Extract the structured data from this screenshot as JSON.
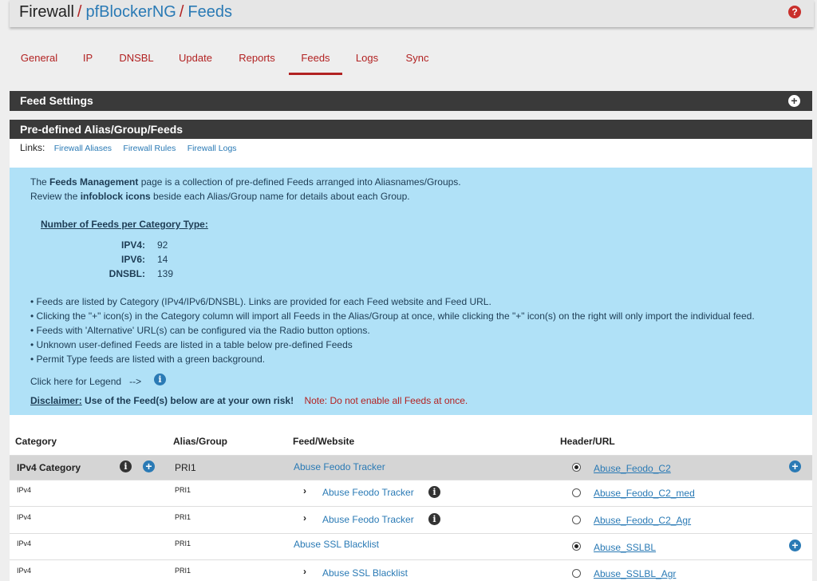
{
  "breadcrumb": {
    "root": "Firewall",
    "sep": "/",
    "package": "pfBlockerNG",
    "page": "Feeds"
  },
  "help_icon": "?",
  "tabs": [
    {
      "label": "General"
    },
    {
      "label": "IP"
    },
    {
      "label": "DNSBL"
    },
    {
      "label": "Update"
    },
    {
      "label": "Reports"
    },
    {
      "label": "Feeds",
      "active": true
    },
    {
      "label": "Logs"
    },
    {
      "label": "Sync"
    }
  ],
  "feed_settings": {
    "title": "Feed Settings",
    "toggle": "+"
  },
  "predefined": {
    "title": "Pre-defined Alias/Group/Feeds"
  },
  "links": {
    "label": "Links:",
    "items": [
      "Firewall Aliases",
      "Firewall Rules",
      "Firewall Logs"
    ]
  },
  "info": {
    "line1_pre": "The ",
    "line1_bold": "Feeds Management",
    "line1_post": " page is a collection of pre-defined Feeds arranged into Aliasnames/Groups.",
    "line2_pre": "Review the ",
    "line2_bold": "infoblock icons",
    "line2_post": " beside each Alias/Group name for details about each Group.",
    "count_heading": "Number of Feeds per Category Type:",
    "counts": [
      {
        "key": "IPV4:",
        "value": "92"
      },
      {
        "key": "IPV6:",
        "value": "14"
      },
      {
        "key": "DNSBL:",
        "value": "139"
      }
    ],
    "bullets": [
      "• Feeds are listed by Category (IPv4/IPv6/DNSBL). Links are provided for each Feed website and Feed URL.",
      "• Clicking the \"+\" icon(s) in the Category column will import all Feeds in the Alias/Group at once, while clicking the \"+\" icon(s) on the right will only import the individual feed.",
      "• Feeds with 'Alternative' URL(s) can be configured via the Radio button options.",
      "• Unknown user-defined Feeds are listed in a table below pre-defined Feeds",
      "• Permit Type feeds are listed with a green background."
    ],
    "legend_text": "Click here for Legend",
    "legend_arrow": "-->",
    "disclaimer_label": "Disclaimer:",
    "disclaimer_text": " Use of the Feed(s) below are at your own risk!",
    "note": "Note: Do not enable all Feeds at once."
  },
  "table": {
    "headers": {
      "category": "Category",
      "alias": "Alias/Group",
      "feed": "Feed/Website",
      "url": "Header/URL"
    },
    "rows": [
      {
        "category": "IPv4 Category",
        "alias": "PRI1",
        "feed": "Abuse Feodo Tracker",
        "url": "Abuse_Feodo_C2"
      },
      {
        "category": "IPv4",
        "alias": "PRI1",
        "feed": "Abuse Feodo Tracker",
        "url": "Abuse_Feodo_C2_med"
      },
      {
        "category": "IPv4",
        "alias": "PRI1",
        "feed": "Abuse Feodo Tracker",
        "url": "Abuse_Feodo_C2_Agr"
      },
      {
        "category": "IPv4",
        "alias": "PRI1",
        "feed": "Abuse SSL Blacklist",
        "url": "Abuse_SSLBL"
      },
      {
        "category": "IPv4",
        "alias": "PRI1",
        "feed": "Abuse SSL Blacklist",
        "url": "Abuse_SSLBL_Agr"
      }
    ]
  },
  "icons": {
    "info": "i",
    "plus": "+",
    "chevron": "›"
  }
}
